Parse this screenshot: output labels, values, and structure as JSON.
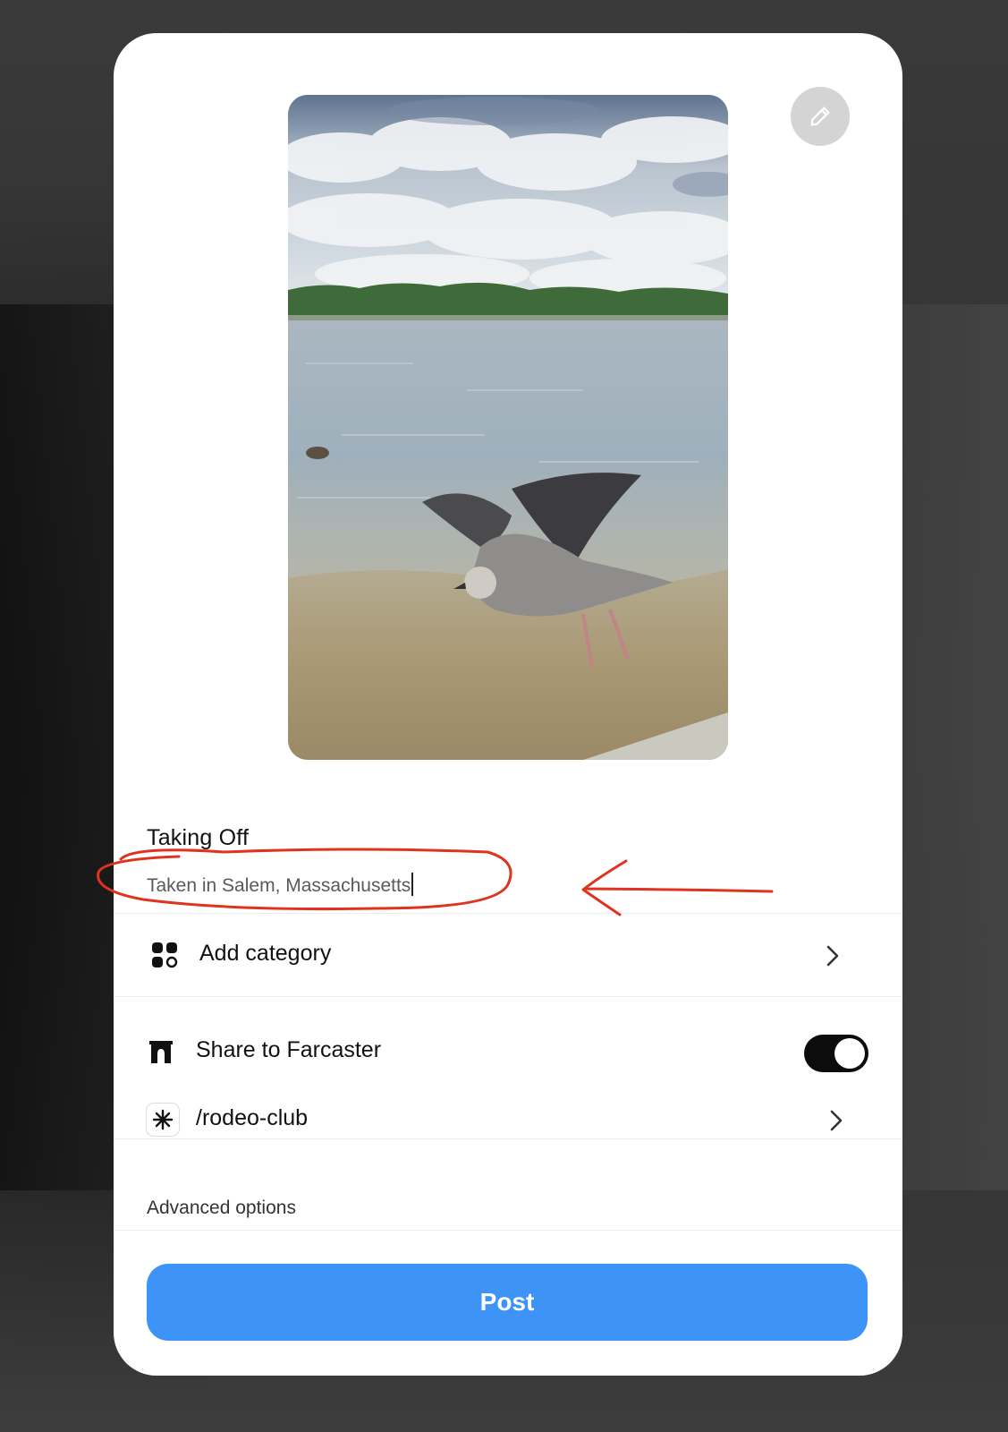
{
  "post_form": {
    "title_value": "Taking Off",
    "description_value": "Taken in Salem, Massachusetts",
    "category_label": "Add category",
    "share_label": "Share to Farcaster",
    "share_enabled": true,
    "channel_label": "/rodeo-club",
    "advanced_label": "Advanced options",
    "post_label": "Post"
  },
  "icons": {
    "edit": "pencil-icon",
    "category": "category-grid-icon",
    "farcaster": "farcaster-arch-icon",
    "channel": "channel-asterisk-icon",
    "chevron": "chevron-right-icon"
  },
  "colors": {
    "accent": "#3d94f6",
    "toggle_on": "#0c0c0c",
    "annotation": "#e0331f",
    "modal_bg": "#ffffff"
  }
}
